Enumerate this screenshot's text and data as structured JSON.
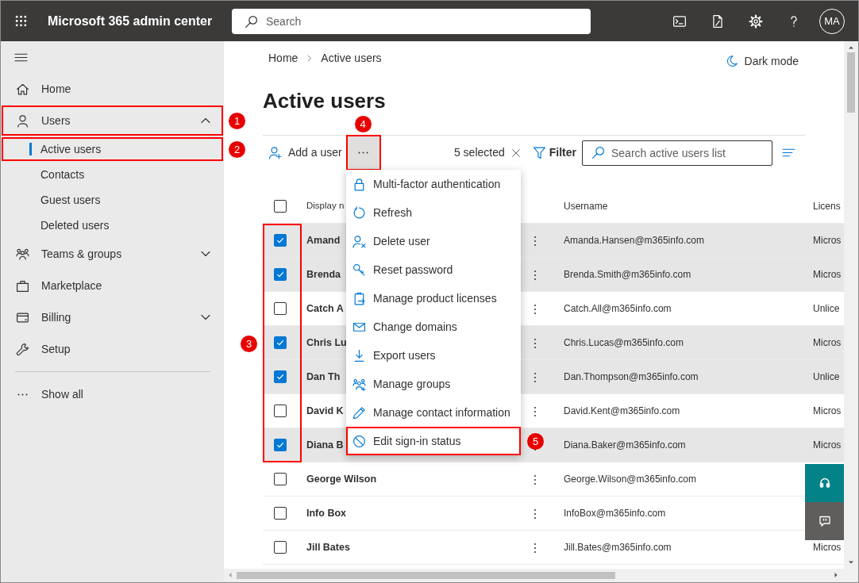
{
  "app": {
    "title": "Microsoft 365 admin center"
  },
  "top_search": {
    "placeholder": "Search"
  },
  "account": {
    "initials": "MA"
  },
  "sidebar": {
    "items": [
      {
        "label": "Home",
        "selected": false,
        "highlighted": false
      },
      {
        "label": "Users",
        "selected": false,
        "highlighted": true,
        "annotation": "1",
        "expanded": true,
        "children": [
          {
            "label": "Active users",
            "selected": true,
            "highlighted": true,
            "annotation": "2"
          },
          {
            "label": "Contacts",
            "selected": false,
            "highlighted": false
          },
          {
            "label": "Guest users",
            "selected": false,
            "highlighted": false
          },
          {
            "label": "Deleted users",
            "selected": false,
            "highlighted": false
          }
        ]
      },
      {
        "label": "Teams & groups",
        "selected": false,
        "highlighted": false,
        "expanded": false
      },
      {
        "label": "Marketplace",
        "selected": false,
        "highlighted": false
      },
      {
        "label": "Billing",
        "selected": false,
        "highlighted": false,
        "expanded": false
      },
      {
        "label": "Setup",
        "selected": false,
        "highlighted": false
      }
    ],
    "footer": {
      "label": "Show all"
    }
  },
  "breadcrumb": [
    "Home",
    "Active users"
  ],
  "dark_mode": {
    "label": "Dark mode"
  },
  "page_title": "Active users",
  "toolbar": {
    "add_user": "Add a user",
    "more": {
      "highlighted": true,
      "annotation": "4"
    },
    "selection_count": "5 selected",
    "filter": "Filter",
    "search": {
      "placeholder": "Search active users list"
    }
  },
  "table": {
    "columns": [
      "Display n",
      "Username",
      "Licens"
    ],
    "header_checked": false,
    "annotation": "3",
    "rows": [
      {
        "name": "Amand",
        "username": "Amanda.Hansen@m365info.com",
        "license": "Micros",
        "selected": true
      },
      {
        "name": "Brenda",
        "username": "Brenda.Smith@m365info.com",
        "license": "Micros",
        "selected": true
      },
      {
        "name": "Catch A",
        "username": "Catch.All@m365info.com",
        "license": "Unlice",
        "selected": false
      },
      {
        "name": "Chris Lu",
        "username": "Chris.Lucas@m365info.com",
        "license": "Micros",
        "selected": true
      },
      {
        "name": "Dan Th",
        "username": "Dan.Thompson@m365info.com",
        "license": "Unlice",
        "selected": true
      },
      {
        "name": "David K",
        "username": "David.Kent@m365info.com",
        "license": "Micros",
        "selected": false
      },
      {
        "name": "Diana B",
        "username": "Diana.Baker@m365info.com",
        "license": "Micros",
        "selected": true
      },
      {
        "name": "George Wilson",
        "username": "George.Wilson@m365info.com",
        "selected": false
      },
      {
        "name": "Info Box",
        "username": "InfoBox@m365info.com",
        "selected": false
      },
      {
        "name": "Jill Bates",
        "username": "Jill.Bates@m365info.com",
        "license": "Micros",
        "selected": false
      }
    ]
  },
  "menu": {
    "items": [
      {
        "label": "Multi-factor authentication",
        "highlighted": false
      },
      {
        "label": "Refresh",
        "highlighted": false
      },
      {
        "label": "Delete user",
        "highlighted": false
      },
      {
        "label": "Reset password",
        "highlighted": false
      },
      {
        "label": "Manage product licenses",
        "highlighted": false
      },
      {
        "label": "Change domains",
        "highlighted": false
      },
      {
        "label": "Export users",
        "highlighted": false
      },
      {
        "label": "Manage groups",
        "highlighted": false
      },
      {
        "label": "Manage contact information",
        "highlighted": false
      },
      {
        "label": "Edit sign-in status",
        "highlighted": true,
        "annotation": "5"
      }
    ]
  }
}
